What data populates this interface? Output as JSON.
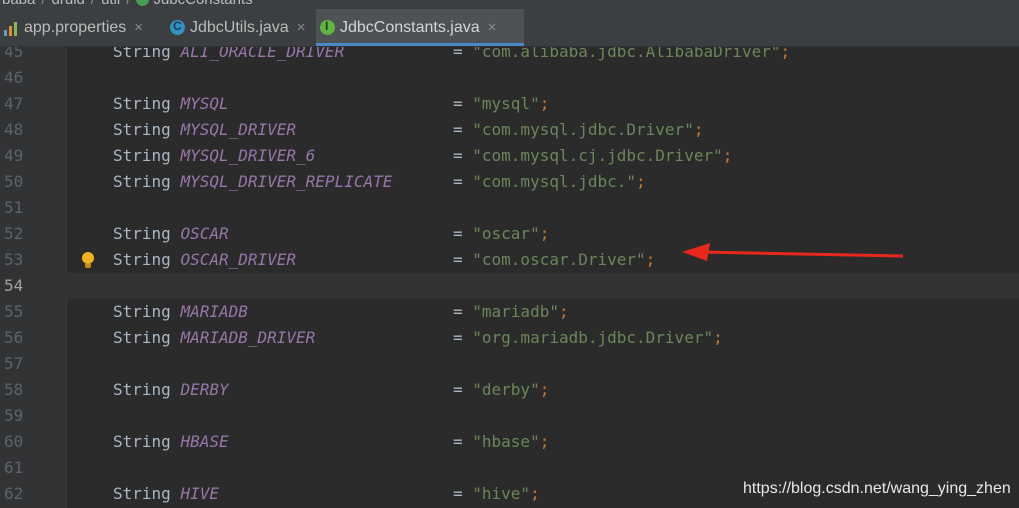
{
  "breadcrumb": {
    "items": [
      "baba",
      "druid",
      "util",
      "JdbcConstants"
    ]
  },
  "tabs": [
    {
      "label": "app.properties",
      "icon": "properties-file-icon",
      "active": false
    },
    {
      "label": "JdbcUtils.java",
      "icon": "class-icon",
      "active": false
    },
    {
      "label": "JdbcConstants.java",
      "icon": "interface-icon",
      "active": true
    }
  ],
  "close_glyph": "×",
  "code_lines": [
    {
      "num": "45",
      "type": "String",
      "name": "ALI_ORACLE_DRIVER",
      "value": "\"com.alibaba.jdbc.AlibabaDriver\""
    },
    {
      "num": "46"
    },
    {
      "num": "47",
      "type": "String",
      "name": "MYSQL",
      "value": "\"mysql\""
    },
    {
      "num": "48",
      "type": "String",
      "name": "MYSQL_DRIVER",
      "value": "\"com.mysql.jdbc.Driver\""
    },
    {
      "num": "49",
      "type": "String",
      "name": "MYSQL_DRIVER_6",
      "value": "\"com.mysql.cj.jdbc.Driver\""
    },
    {
      "num": "50",
      "type": "String",
      "name": "MYSQL_DRIVER_REPLICATE",
      "value": "\"com.mysql.jdbc.\""
    },
    {
      "num": "51"
    },
    {
      "num": "52",
      "type": "String",
      "name": "OSCAR",
      "value": "\"oscar\""
    },
    {
      "num": "53",
      "type": "String",
      "name": "OSCAR_DRIVER",
      "value": "\"com.oscar.Driver\"",
      "bulb": true
    },
    {
      "num": "54",
      "current": true
    },
    {
      "num": "55",
      "type": "String",
      "name": "MARIADB",
      "value": "\"mariadb\""
    },
    {
      "num": "56",
      "type": "String",
      "name": "MARIADB_DRIVER",
      "value": "\"org.mariadb.jdbc.Driver\""
    },
    {
      "num": "57"
    },
    {
      "num": "58",
      "type": "String",
      "name": "DERBY",
      "value": "\"derby\""
    },
    {
      "num": "59"
    },
    {
      "num": "60",
      "type": "String",
      "name": "HBASE",
      "value": "\"hbase\""
    },
    {
      "num": "61"
    },
    {
      "num": "62",
      "type": "String",
      "name": "HIVE",
      "value": "\"hive\""
    }
  ],
  "watermark": "https://blog.csdn.net/wang_ying_zhen",
  "colors": {
    "background": "#2b2b2b",
    "keyword": "#a9b7c6",
    "constant": "#9876aa",
    "string": "#6a8759",
    "semicolon": "#cc7832",
    "arrow": "#e8281f",
    "active_tab_underline": "#4a88c7"
  }
}
